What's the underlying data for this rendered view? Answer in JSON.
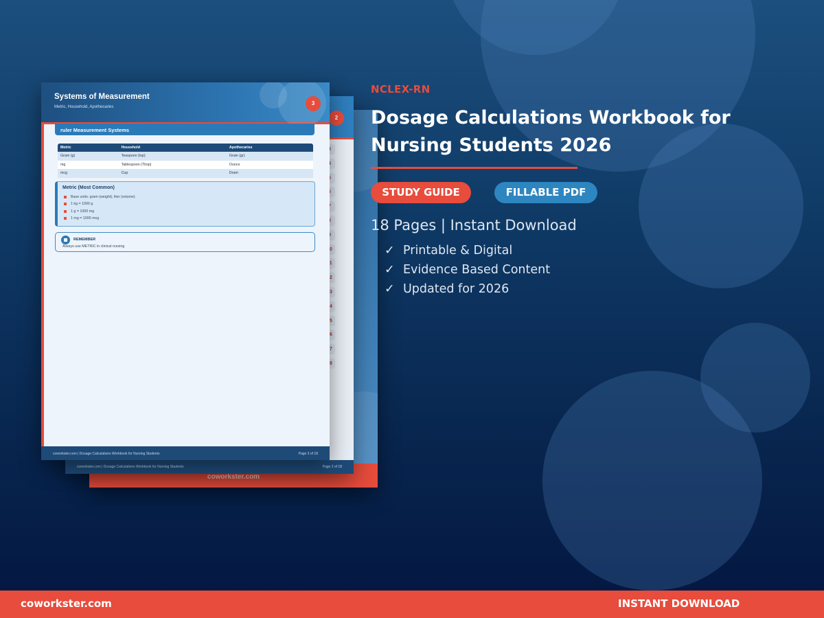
{
  "colors": {
    "accent": "#e74c3c",
    "primary_blue": "#2e86c1",
    "background_dark": "#031640",
    "background_light": "#1c4f7e"
  },
  "back_page": {
    "brand": "coworkster.com"
  },
  "middle_page": {
    "page_badge": "2",
    "toc_numbers": [
      "3",
      "4",
      "5",
      "6",
      "7",
      "8",
      "9",
      "10",
      "11",
      "12",
      "13",
      "14",
      "15",
      "16",
      "17",
      "18"
    ],
    "footer_left": "coworkster.com  |  Dosage Calculations Workbook for Nursing Students",
    "footer_right": "Page 2 of 18"
  },
  "front_page": {
    "title": "Systems of Measurement",
    "subtitle": "Metric, Household, Apothecaries",
    "page_badge": "3",
    "section_title": "ruler  Measurement Systems",
    "table": {
      "headers": [
        "Metric",
        "Household",
        "Apothecaries"
      ],
      "rows": [
        [
          "Gram (g)",
          "Teaspoon (tsp)",
          "Grain (gr)"
        ],
        [
          "mg",
          "Tablespoon (Tbsp)",
          "Ounce"
        ],
        [
          "mcg",
          "Cup",
          "Dram"
        ]
      ]
    },
    "metric_box": {
      "title": "Metric (Most Common)",
      "items": [
        "Base units: gram (weight), liter (volume)",
        "1 kg = 1000 g",
        "1 g = 1000 mg",
        "1 mg = 1000 mcg"
      ]
    },
    "remember": {
      "title": "REMEMBER",
      "text": "Always use METRIC in clinical nursing"
    },
    "footer_left": "coworkster.com  |  Dosage Calculations Workbook for Nursing Students",
    "footer_right": "Page 3 of 18"
  },
  "product": {
    "eyebrow": "NCLEX-RN",
    "title": "Dosage Calculations Workbook for Nursing Students 2026",
    "badges": [
      "STUDY GUIDE",
      "FILLABLE PDF"
    ],
    "pages_line": "18 Pages | Instant Download",
    "check_icon": "✓",
    "features": [
      "Printable & Digital",
      "Evidence Based Content",
      "Updated for 2026"
    ]
  },
  "bottom_bar": {
    "left": "coworkster.com",
    "right": "INSTANT DOWNLOAD"
  }
}
